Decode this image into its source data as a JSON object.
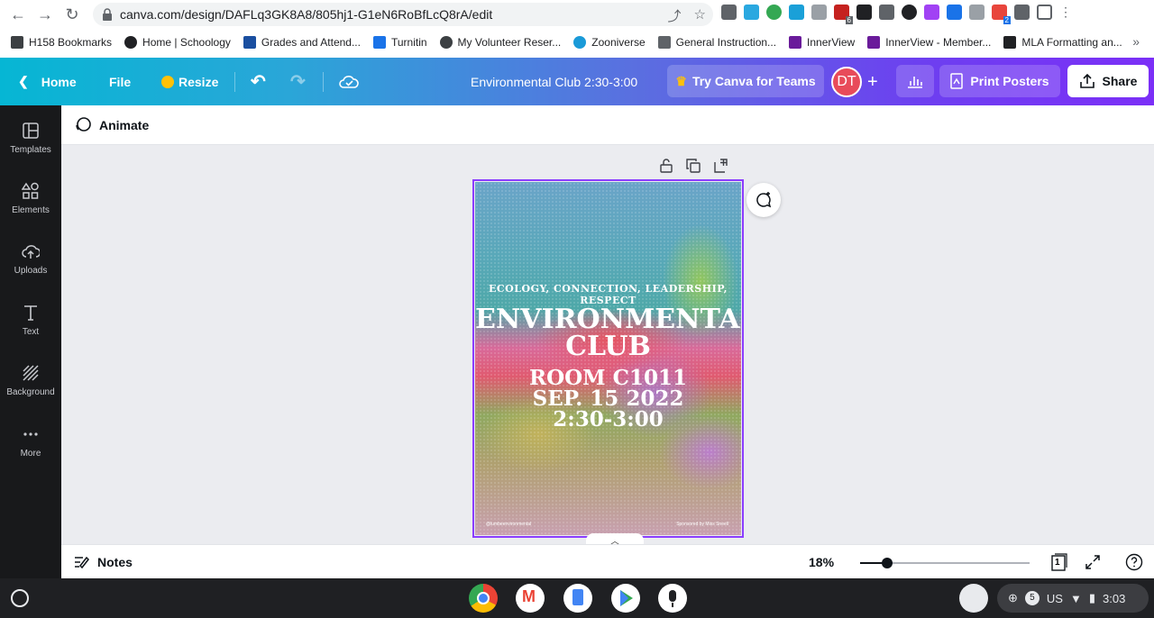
{
  "browser": {
    "url": "canva.com/design/DAFLq3GK8A8/805hj1-G1eN6RoBfLcQ8rA/edit",
    "bookmarks": [
      {
        "label": "H158 Bookmarks"
      },
      {
        "label": "Home | Schoology"
      },
      {
        "label": "Grades and Attend..."
      },
      {
        "label": "Turnitin"
      },
      {
        "label": "My Volunteer Reser..."
      },
      {
        "label": "Zooniverse"
      },
      {
        "label": "General Instruction..."
      },
      {
        "label": "InnerView"
      },
      {
        "label": "InnerView - Member..."
      },
      {
        "label": "MLA Formatting an..."
      }
    ],
    "bookmarks_overflow": "»",
    "extension_badge_1": "6",
    "extension_badge_2": "2"
  },
  "header": {
    "home": "Home",
    "file": "File",
    "resize": "Resize",
    "doc_title": "Environmental Club 2:30-3:00",
    "teams": "Try Canva for Teams",
    "avatar_initials": "DT",
    "print": "Print Posters",
    "share": "Share"
  },
  "sidebar": {
    "items": [
      {
        "label": "Templates"
      },
      {
        "label": "Elements"
      },
      {
        "label": "Uploads"
      },
      {
        "label": "Text"
      },
      {
        "label": "Background"
      },
      {
        "label": "More"
      }
    ]
  },
  "toolbar": {
    "animate": "Animate"
  },
  "poster": {
    "subtitle": "ECOLOGY, CONNECTION, LEADERSHIP, RESPECT",
    "title_line1": "ENVIRONMENTAL",
    "title_line2": "CLUB",
    "room": "ROOM C1011",
    "date": "SEP. 15 2022",
    "time": "2:30-3:00",
    "footer_left": "@lumbeenvironmental",
    "footer_right": "Sponsored by Miss Sneell"
  },
  "footer": {
    "notes": "Notes",
    "zoom": "18%",
    "zoom_fraction": 0.18,
    "page_count": "1"
  },
  "shelf": {
    "notifications": "5",
    "locale": "US",
    "time": "3:03"
  }
}
